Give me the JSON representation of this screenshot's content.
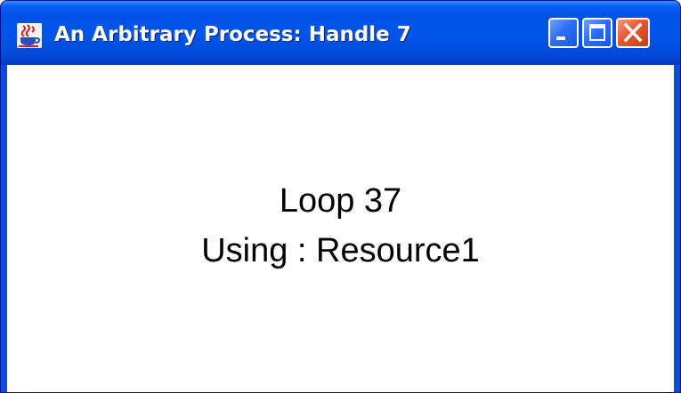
{
  "window": {
    "title": "An Arbitrary Process: Handle 7",
    "icon": "java-coffee-cup-icon",
    "controls": {
      "minimize": "minimize-icon",
      "maximize": "maximize-icon",
      "close": "close-icon"
    }
  },
  "content": {
    "loop_text": "Loop 37",
    "resource_text": "Using : Resource1"
  },
  "colors": {
    "titlebar": "#0055ea",
    "close_button": "#e3582f",
    "client_background": "#ffffff",
    "text": "#000000"
  }
}
